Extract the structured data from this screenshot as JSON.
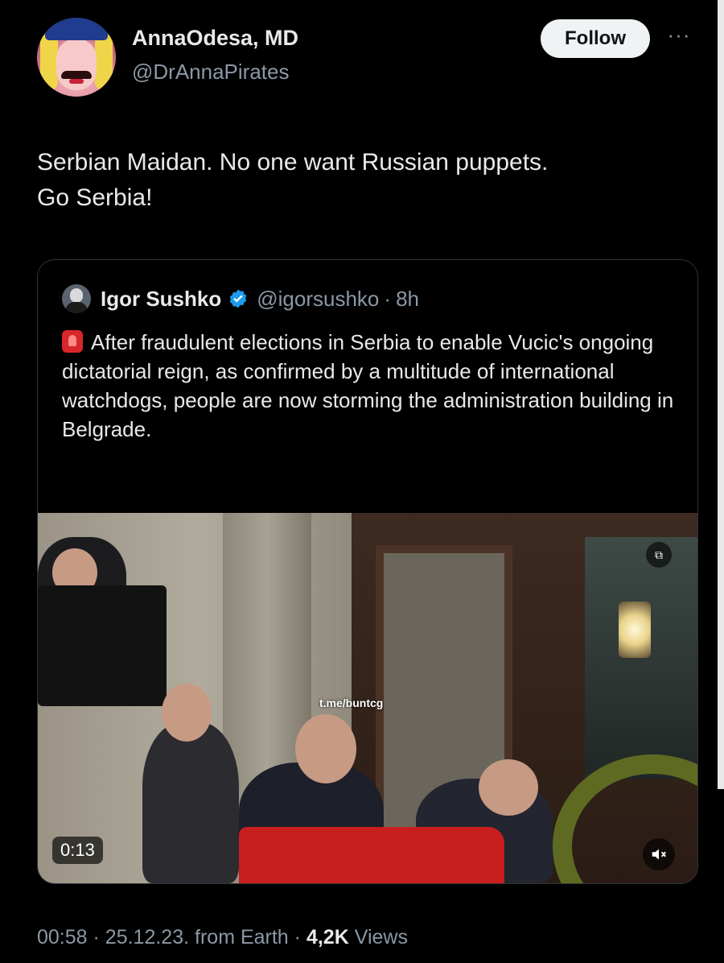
{
  "author": {
    "name": "AnnaOdesa, MD",
    "handle": "@DrAnnaPirates",
    "avatar": "avatar-image"
  },
  "actions": {
    "follow_label": "Follow",
    "more_icon": "more-horizontal-icon"
  },
  "tweet": {
    "text_line1": "Serbian Maidan. No one want Russian puppets.",
    "text_line2": "Go Serbia!"
  },
  "quote": {
    "name": "Igor Sushko",
    "verified_icon": "verified-badge-icon",
    "handle": "@igorsushko",
    "separator": "·",
    "time": "8h",
    "siren_icon": "rotating-light-icon",
    "text": "After fraudulent elections in Serbia to enable Vucic's ongoing dictatorial reign, as confirmed by a multitude of international watchdogs, people are now storming the administration building in Belgrade.",
    "media": {
      "watermark": "t.me/buntcg",
      "duration": "0:13",
      "gif_icon": "gif-icon",
      "mute_icon": "speaker-muted-icon"
    }
  },
  "meta": {
    "time": "00:58",
    "sep1": "·",
    "date": "25.12.23.",
    "source": "from Earth",
    "sep2": "·",
    "views_count": "4,2K",
    "views_label": "Views"
  },
  "colors": {
    "background": "#000000",
    "text": "#e7e9ea",
    "secondary": "#8b98a5",
    "verified": "#1d9bf0",
    "follow_bg": "#eff3f4"
  }
}
